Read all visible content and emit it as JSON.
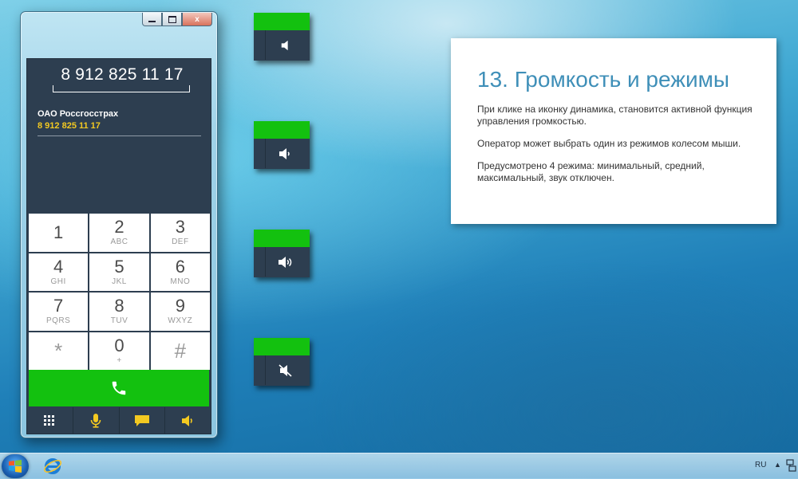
{
  "window": {
    "minimize_glyph": "",
    "close_glyph": "x"
  },
  "dialer": {
    "number": "8 912 825 11 17",
    "contact_name": "ОАО Россгосстрах",
    "contact_number": "8 912 825 11 17",
    "keys": [
      {
        "digit": "1",
        "letters": ""
      },
      {
        "digit": "2",
        "letters": "ABC"
      },
      {
        "digit": "3",
        "letters": "DEF"
      },
      {
        "digit": "4",
        "letters": "GHI"
      },
      {
        "digit": "5",
        "letters": "JKL"
      },
      {
        "digit": "6",
        "letters": "MNO"
      },
      {
        "digit": "7",
        "letters": "PQRS"
      },
      {
        "digit": "8",
        "letters": "TUV"
      },
      {
        "digit": "9",
        "letters": "WXYZ"
      },
      {
        "digit": "*",
        "letters": ""
      },
      {
        "digit": "0",
        "letters": "+"
      },
      {
        "digit": "#",
        "letters": ""
      }
    ],
    "toolbar_icons": [
      "keypad-icon",
      "microphone-icon",
      "message-icon",
      "speaker-icon"
    ]
  },
  "volume_modes": [
    "minimal",
    "medium",
    "maximal",
    "muted"
  ],
  "info": {
    "title": "13. Громкость и режимы",
    "paragraphs": [
      "При клике на иконку динамика, становится активной функция управления громкостью.",
      "Оператор может выбрать один из режимов колесом мыши.",
      "Предусмотрено 4 режима: минимальный, средний, максимальный, звук отключен."
    ]
  },
  "taskbar": {
    "language": "RU",
    "tray_arrow": "▲"
  },
  "colors": {
    "accent_green": "#13c10f",
    "panel_dark": "#2d3e50",
    "highlight_yellow": "#f3c921",
    "title_blue": "#3f8fb8"
  }
}
